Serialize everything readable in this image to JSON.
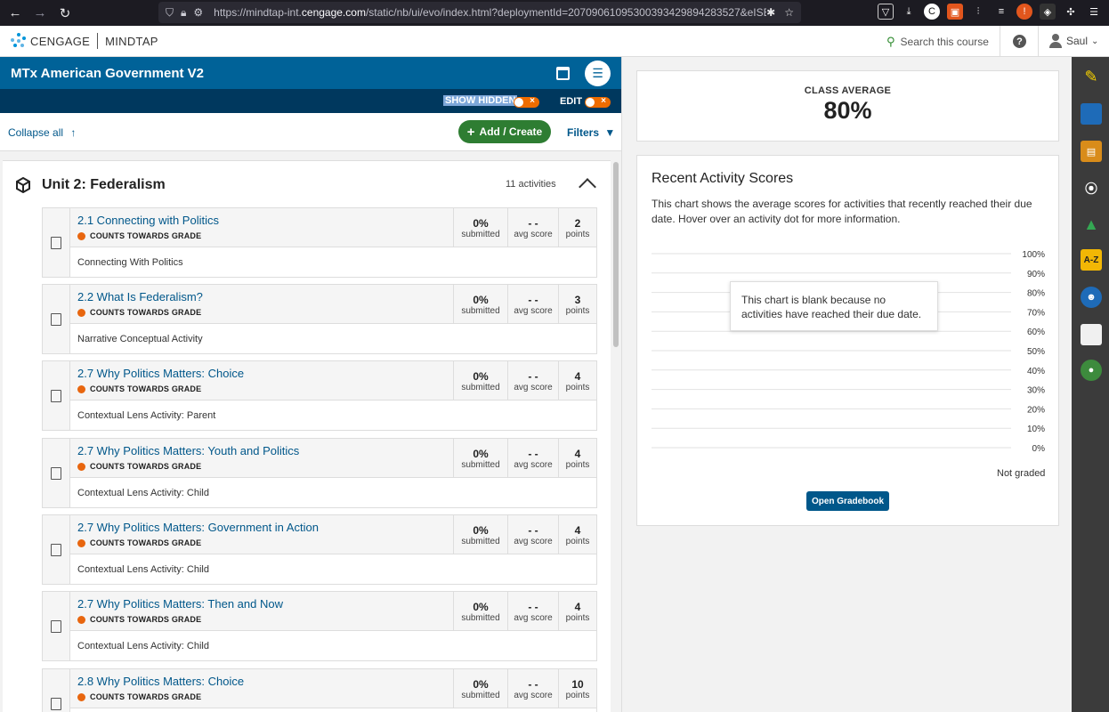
{
  "browser": {
    "url_prefix": "https://mindtap-int.",
    "url_domain": "cengage.com",
    "url_rest": "/static/nb/ui/evo/index.html?deploymentId=20709061095300393429894283527&eISBN"
  },
  "header": {
    "brand_left": "CENGAGE",
    "brand_right": "MINDTAP",
    "search_label": "Search this course",
    "user_name": "Saul"
  },
  "course": {
    "title": "MTx American Government V2",
    "show_hidden_label": "SHOW HIDDEN",
    "edit_label": "EDIT"
  },
  "actions": {
    "collapse_all": "Collapse all",
    "add_create": "Add / Create",
    "filters": "Filters"
  },
  "unit": {
    "title": "Unit 2: Federalism",
    "count": "11 activities"
  },
  "stat_labels": {
    "submitted": "submitted",
    "avg_score": "avg score",
    "points": "points"
  },
  "activities": [
    {
      "title": "2.1 Connecting with Politics",
      "badge": "COUNTS TOWARDS GRADE",
      "submitted": "0%",
      "avg": "- -",
      "points": "2",
      "desc": "Connecting With Politics"
    },
    {
      "title": "2.2 What Is Federalism?",
      "badge": "COUNTS TOWARDS GRADE",
      "submitted": "0%",
      "avg": "- -",
      "points": "3",
      "desc": "Narrative Conceptual Activity"
    },
    {
      "title": "2.7 Why Politics Matters: Choice",
      "badge": "COUNTS TOWARDS GRADE",
      "submitted": "0%",
      "avg": "- -",
      "points": "4",
      "desc": "Contextual Lens Activity: Parent"
    },
    {
      "title": "2.7 Why Politics Matters: Youth and Politics",
      "badge": "COUNTS TOWARDS GRADE",
      "submitted": "0%",
      "avg": "- -",
      "points": "4",
      "desc": "Contextual Lens Activity: Child"
    },
    {
      "title": "2.7 Why Politics Matters: Government in Action",
      "badge": "COUNTS TOWARDS GRADE",
      "submitted": "0%",
      "avg": "- -",
      "points": "4",
      "desc": "Contextual Lens Activity: Child"
    },
    {
      "title": "2.7 Why Politics Matters: Then and Now",
      "badge": "COUNTS TOWARDS GRADE",
      "submitted": "0%",
      "avg": "- -",
      "points": "4",
      "desc": "Contextual Lens Activity: Child"
    },
    {
      "title": "2.8 Why Politics Matters: Choice",
      "badge": "COUNTS TOWARDS GRADE",
      "submitted": "0%",
      "avg": "- -",
      "points": "10",
      "desc": ""
    }
  ],
  "class_average": {
    "label": "CLASS AVERAGE",
    "value": "80%"
  },
  "recent_scores": {
    "title": "Recent Activity Scores",
    "description": "This chart shows the average scores for activities that recently reached their due date. Hover over an activity dot for more information.",
    "tooltip": "This chart is blank because no activities have reached their due date.",
    "not_graded": "Not graded",
    "button": "Open Gradebook"
  },
  "chart_data": {
    "type": "scatter",
    "y_ticks": [
      "100%",
      "90%",
      "80%",
      "70%",
      "60%",
      "50%",
      "40%",
      "30%",
      "20%",
      "10%",
      "0%"
    ],
    "ylim": [
      0,
      100
    ],
    "points": []
  },
  "colors": {
    "course_bar": "#006298",
    "sub_bar": "#00385e",
    "add_button": "#2e7d32",
    "toggle": "#ef6c00",
    "grade_dot": "#e8660f",
    "link": "#00578a"
  },
  "dock_icons": [
    "pencil-icon",
    "book-icon",
    "reader-icon",
    "audio-icon",
    "drive-icon",
    "dictionary-icon",
    "brain-icon",
    "notes-icon",
    "profile-icon"
  ]
}
